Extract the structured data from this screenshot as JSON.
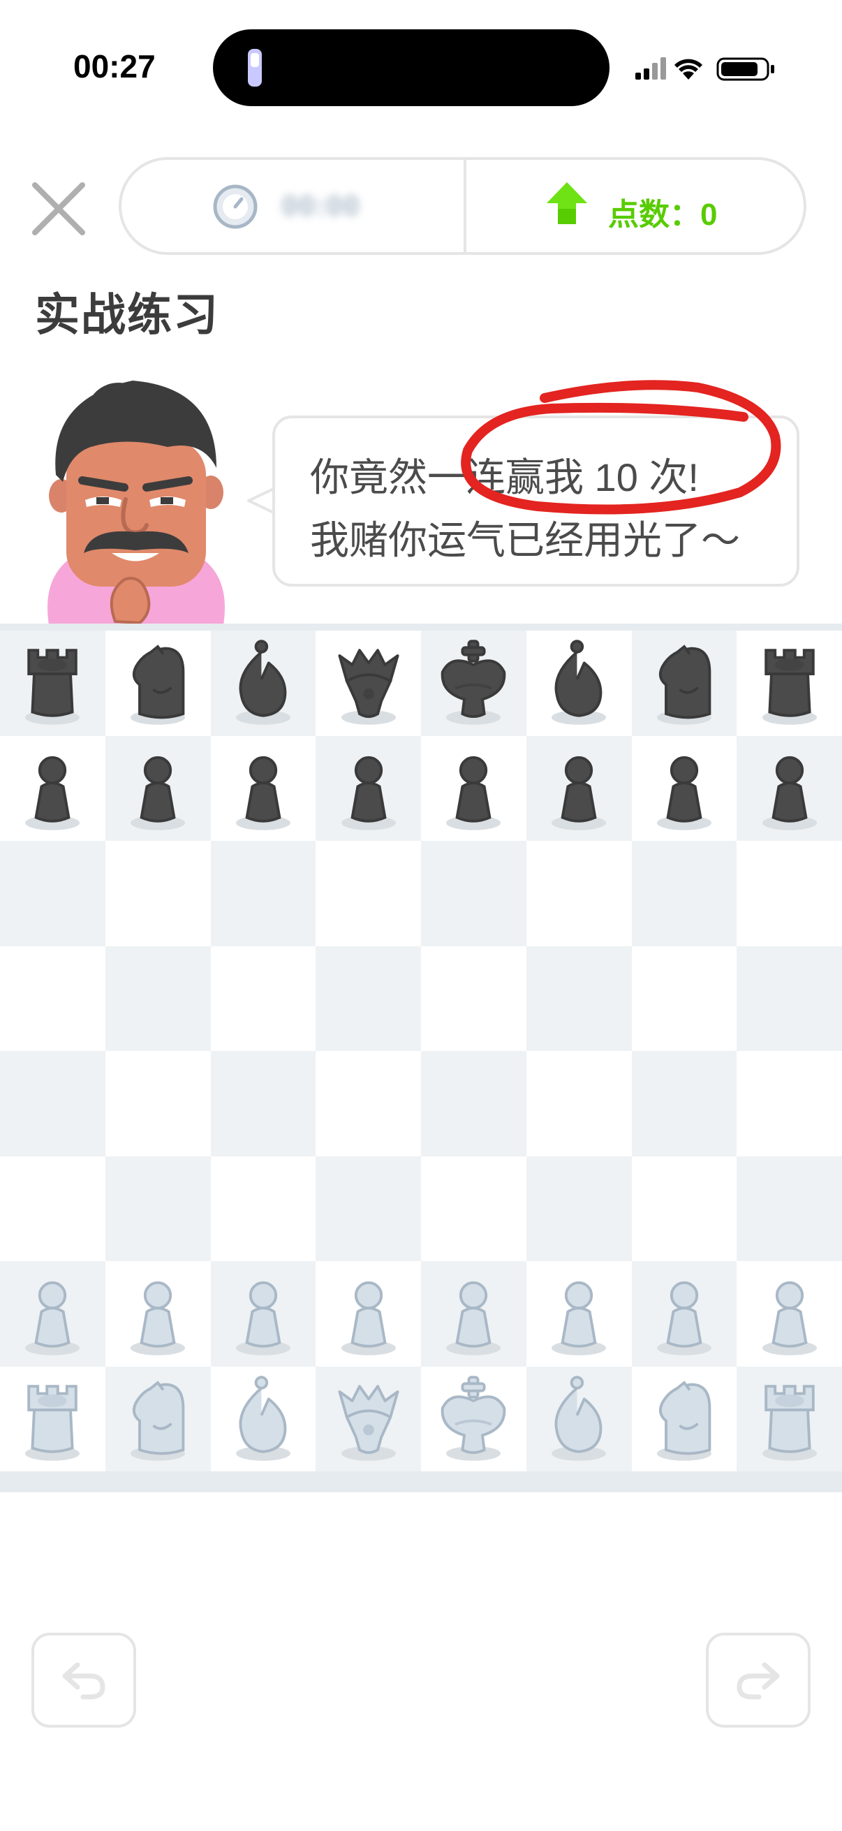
{
  "status_bar": {
    "time": "00:27"
  },
  "header": {
    "timer_value": "00:00",
    "points_label": "点数：",
    "points_value": "0",
    "points_color": "#58cc02"
  },
  "page_title": "实战练习",
  "speech": {
    "line1": "你竟然一连赢我 10 次!",
    "line2": "我赌你运气已经用光了～"
  },
  "board": {
    "light_square": "#ffffff",
    "dark_square": "#eef2f4",
    "black_piece_color": "#4b4b4b",
    "white_piece_color": "#d5dfe8",
    "ranks": [
      [
        "black-rook",
        "black-knight",
        "black-bishop",
        "black-queen",
        "black-king",
        "black-bishop",
        "black-knight",
        "black-rook"
      ],
      [
        "black-pawn",
        "black-pawn",
        "black-pawn",
        "black-pawn",
        "black-pawn",
        "black-pawn",
        "black-pawn",
        "black-pawn"
      ],
      [
        "",
        "",
        "",
        "",
        "",
        "",
        "",
        ""
      ],
      [
        "",
        "",
        "",
        "",
        "",
        "",
        "",
        ""
      ],
      [
        "",
        "",
        "",
        "",
        "",
        "",
        "",
        ""
      ],
      [
        "",
        "",
        "",
        "",
        "",
        "",
        "",
        ""
      ],
      [
        "white-pawn",
        "white-pawn",
        "white-pawn",
        "white-pawn",
        "white-pawn",
        "white-pawn",
        "white-pawn",
        "white-pawn"
      ],
      [
        "white-rook",
        "white-knight",
        "white-bishop",
        "white-queen",
        "white-king",
        "white-bishop",
        "white-knight",
        "white-rook"
      ]
    ]
  },
  "icons": {
    "close": "close-icon",
    "timer": "timer-icon",
    "points": "up-arrow-icon",
    "undo": "undo-icon",
    "redo": "redo-icon"
  }
}
